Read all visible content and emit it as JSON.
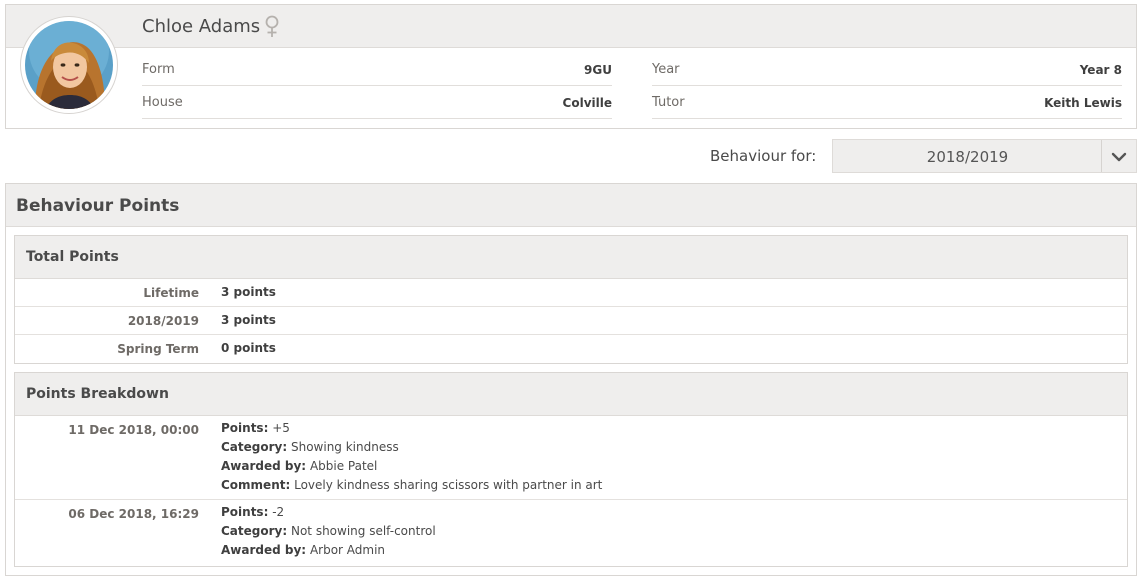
{
  "student": {
    "name": "Chloe Adams",
    "gender_icon": "female-icon",
    "fields": {
      "form_label": "Form",
      "form_value": "9GU",
      "year_label": "Year",
      "year_value": "Year 8",
      "house_label": "House",
      "house_value": "Colville",
      "tutor_label": "Tutor",
      "tutor_value": "Keith Lewis"
    }
  },
  "filter": {
    "label": "Behaviour for:",
    "selected": "2018/2019",
    "icon": "chevron-down-icon"
  },
  "behaviour_points": {
    "title": "Behaviour Points",
    "total_points": {
      "title": "Total Points",
      "rows": [
        {
          "label": "Lifetime",
          "value": "3 points"
        },
        {
          "label": "2018/2019",
          "value": "3 points"
        },
        {
          "label": "Spring Term",
          "value": "0 points"
        }
      ]
    },
    "breakdown": {
      "title": "Points Breakdown",
      "entries": [
        {
          "date": "11 Dec 2018, 00:00",
          "points_label": "Points:",
          "points": "+5",
          "category_label": "Category:",
          "category": "Showing kindness",
          "awarded_label": "Awarded by:",
          "awarded_by": "Abbie Patel",
          "comment_label": "Comment:",
          "comment": "Lovely kindness sharing scissors with partner in art"
        },
        {
          "date": "06 Dec 2018, 16:29",
          "points_label": "Points:",
          "points": "-2",
          "category_label": "Category:",
          "category": "Not showing self-control",
          "awarded_label": "Awarded by:",
          "awarded_by": "Arbor Admin"
        }
      ]
    }
  },
  "colors": {
    "header_bg": "#efeeed",
    "border": "#d9d6d3",
    "text": "#4a4a4a"
  }
}
